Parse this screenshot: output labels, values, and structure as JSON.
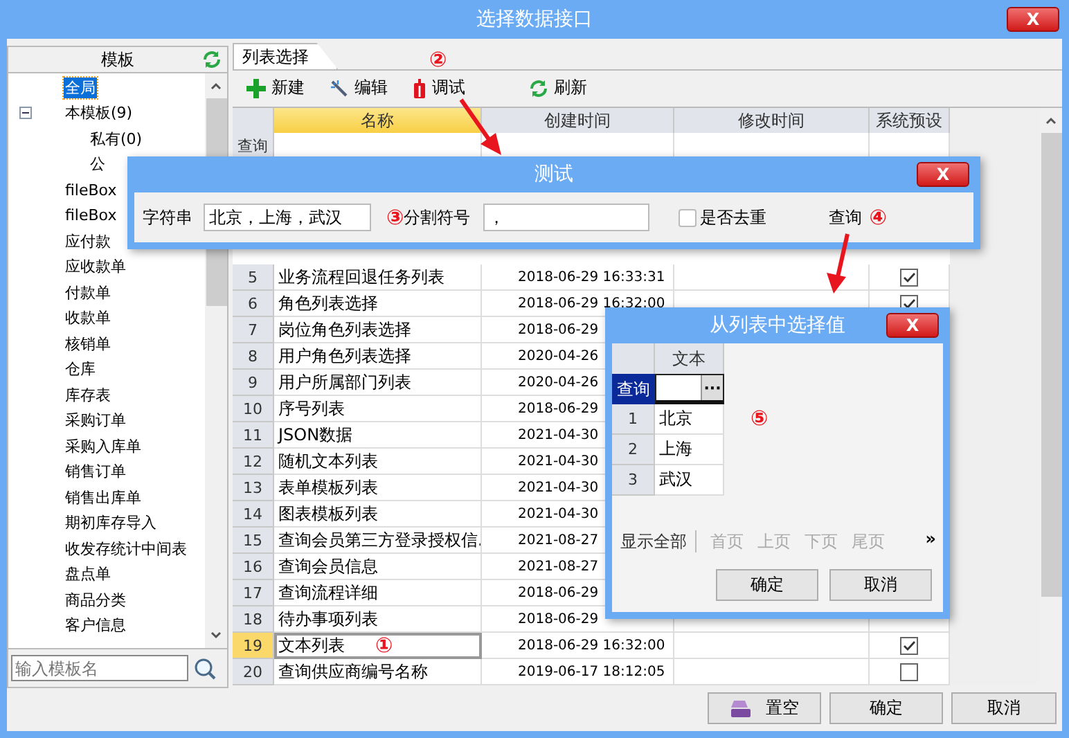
{
  "window": {
    "title": "选择数据接口",
    "close": "X"
  },
  "sidebar": {
    "header": "模板",
    "items": [
      {
        "label": "全局",
        "selected": true
      },
      {
        "label": "本模板(9)",
        "selected": false,
        "expanded": true,
        "children": [
          {
            "label": "私有(0)",
            "selected": false
          },
          {
            "label": "公",
            "selected": false
          }
        ]
      },
      {
        "label": "fileBox",
        "selected": false
      },
      {
        "label": "fileBox",
        "selected": false
      },
      {
        "label": "应付款",
        "selected": false
      },
      {
        "label": "应收款单",
        "selected": false
      },
      {
        "label": "付款单",
        "selected": false
      },
      {
        "label": "收款单",
        "selected": false
      },
      {
        "label": "核销单",
        "selected": false
      },
      {
        "label": "仓库",
        "selected": false
      },
      {
        "label": "库存表",
        "selected": false
      },
      {
        "label": "采购订单",
        "selected": false
      },
      {
        "label": "采购入库单",
        "selected": false
      },
      {
        "label": "销售订单",
        "selected": false
      },
      {
        "label": "销售出库单",
        "selected": false
      },
      {
        "label": "期初库存导入",
        "selected": false
      },
      {
        "label": "收发存统计中间表",
        "selected": false
      },
      {
        "label": "盘点单",
        "selected": false
      },
      {
        "label": "商品分类",
        "selected": false
      },
      {
        "label": "客户信息",
        "selected": false
      }
    ],
    "search": {
      "placeholder": "输入模板名"
    }
  },
  "tabs": [
    {
      "label": "列表选择",
      "selected": true
    }
  ],
  "toolbar": [
    {
      "label": "新建",
      "kind": "add"
    },
    {
      "label": "编辑",
      "kind": "edit"
    },
    {
      "label": "调试",
      "kind": "debug",
      "marker": "②"
    },
    {
      "label": "刷新",
      "kind": "refresh"
    }
  ],
  "table": {
    "columns": [
      {
        "label": "名称",
        "selected": true
      },
      {
        "label": "创建时间",
        "selected": false
      },
      {
        "label": "修改时间",
        "selected": false
      },
      {
        "label": "系统预设",
        "selected": false
      }
    ],
    "query_label": "查询",
    "rows": [
      {
        "index": "5",
        "name": "业务流程回退任务列表",
        "created": "2018-06-29 16:33:31",
        "preset": true,
        "selected": false
      },
      {
        "index": "6",
        "name": "角色列表选择",
        "created": "2018-06-29 16:32:00",
        "preset": true,
        "selected": false
      },
      {
        "index": "7",
        "name": "岗位角色列表选择",
        "created": "2018-06-29",
        "selected": false
      },
      {
        "index": "8",
        "name": "用户角色列表选择",
        "created": "2020-04-26",
        "selected": false
      },
      {
        "index": "9",
        "name": "用户所属部门列表",
        "created": "2020-04-26",
        "selected": false
      },
      {
        "index": "10",
        "name": "序号列表",
        "created": "2018-06-29",
        "selected": false
      },
      {
        "index": "11",
        "name": "JSON数据",
        "created": "2021-04-30",
        "selected": false
      },
      {
        "index": "12",
        "name": "随机文本列表",
        "created": "2021-04-30",
        "selected": false
      },
      {
        "index": "13",
        "name": "表单模板列表",
        "created": "2021-04-30",
        "selected": false
      },
      {
        "index": "14",
        "name": "图表模板列表",
        "created": "2021-04-30",
        "selected": false
      },
      {
        "index": "15",
        "name": "查询会员第三方登录授权信.",
        "created": "2021-08-27",
        "selected": false
      },
      {
        "index": "16",
        "name": "查询会员信息",
        "created": "2021-08-27",
        "selected": false
      },
      {
        "index": "17",
        "name": "查询流程详细",
        "created": "2018-06-29",
        "selected": false
      },
      {
        "index": "18",
        "name": "待办事项列表",
        "created": "2018-06-29",
        "selected": false
      },
      {
        "index": "19",
        "name": "文本列表",
        "marker": "①",
        "created": "2018-06-29 16:32:00",
        "preset": true,
        "selected": true
      },
      {
        "index": "20",
        "name": "查询供应商编号名称",
        "created": "2019-06-17 18:12:05",
        "preset": false,
        "selected": false
      }
    ]
  },
  "footer_buttons": [
    {
      "label": "置空",
      "kind": "clear"
    },
    {
      "label": "确定",
      "kind": "plain"
    },
    {
      "label": "取消",
      "kind": "plain"
    }
  ],
  "test_dialog": {
    "title": "测试",
    "close": "X",
    "string_label": "字符串",
    "string_value": "北京，上海，武汉",
    "separator_marker": "③",
    "separator_label": "分割符号",
    "separator_value": "，",
    "dedupe": {
      "label": "是否去重",
      "checked": false
    },
    "query": "查询",
    "query_marker": "④"
  },
  "picker_dialog": {
    "title": "从列表中选择值",
    "close": "X",
    "column": "文本",
    "query_label": "查询",
    "query_button": "···",
    "marker": "⑤",
    "rows": [
      {
        "index": "1",
        "value": "北京"
      },
      {
        "index": "2",
        "value": "上海"
      },
      {
        "index": "3",
        "value": "武汉"
      }
    ],
    "show_all": "显示全部",
    "pager": [
      {
        "label": "首页",
        "disabled": true
      },
      {
        "label": "上页",
        "disabled": true
      },
      {
        "label": "下页",
        "disabled": true
      },
      {
        "label": "尾页",
        "disabled": true
      }
    ],
    "more": "»",
    "buttons": [
      "确定",
      "取消"
    ]
  }
}
